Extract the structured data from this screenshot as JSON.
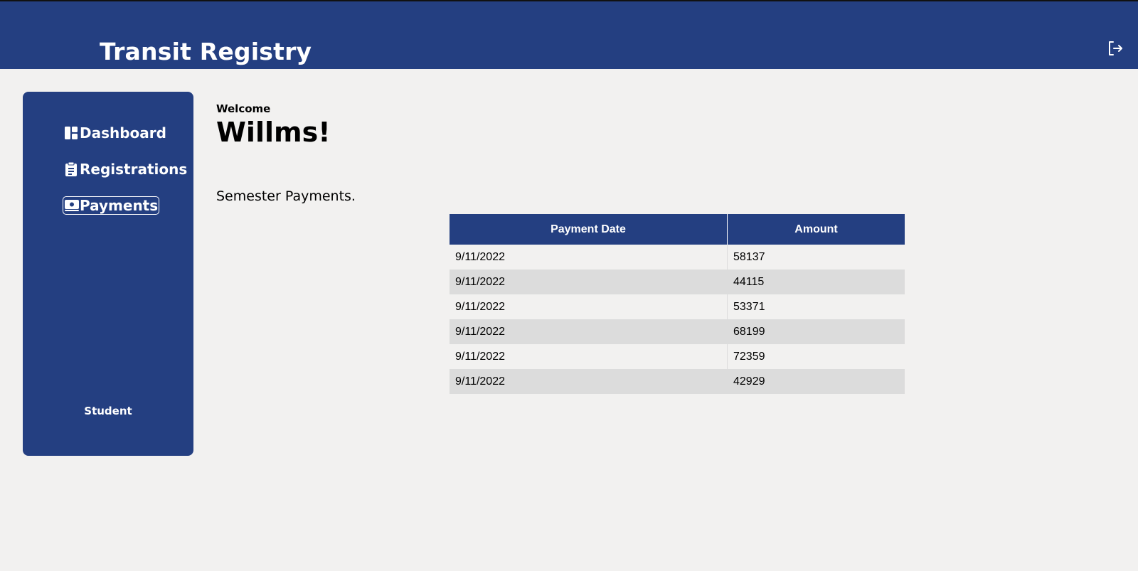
{
  "header": {
    "title": "Transit Registry",
    "logout_icon": "logout-icon"
  },
  "sidebar": {
    "items": [
      {
        "label": "Dashboard",
        "icon": "dashboard-icon",
        "active": false
      },
      {
        "label": "Registrations",
        "icon": "clipboard-icon",
        "active": false
      },
      {
        "label": "Payments",
        "icon": "money-icon",
        "active": true
      }
    ],
    "role": "Student"
  },
  "main": {
    "welcome_label": "Welcome",
    "user_name": "Willms!",
    "section_title": "Semester Payments.",
    "table": {
      "columns": [
        "Payment Date",
        "Amount"
      ],
      "rows": [
        [
          "9/11/2022",
          "58137"
        ],
        [
          "9/11/2022",
          "44115"
        ],
        [
          "9/11/2022",
          "53371"
        ],
        [
          "9/11/2022",
          "68199"
        ],
        [
          "9/11/2022",
          "72359"
        ],
        [
          "9/11/2022",
          "42929"
        ]
      ]
    }
  },
  "colors": {
    "primary": "#243f81",
    "background": "#f2f1f0",
    "row_alt": "#dcdcdc"
  }
}
